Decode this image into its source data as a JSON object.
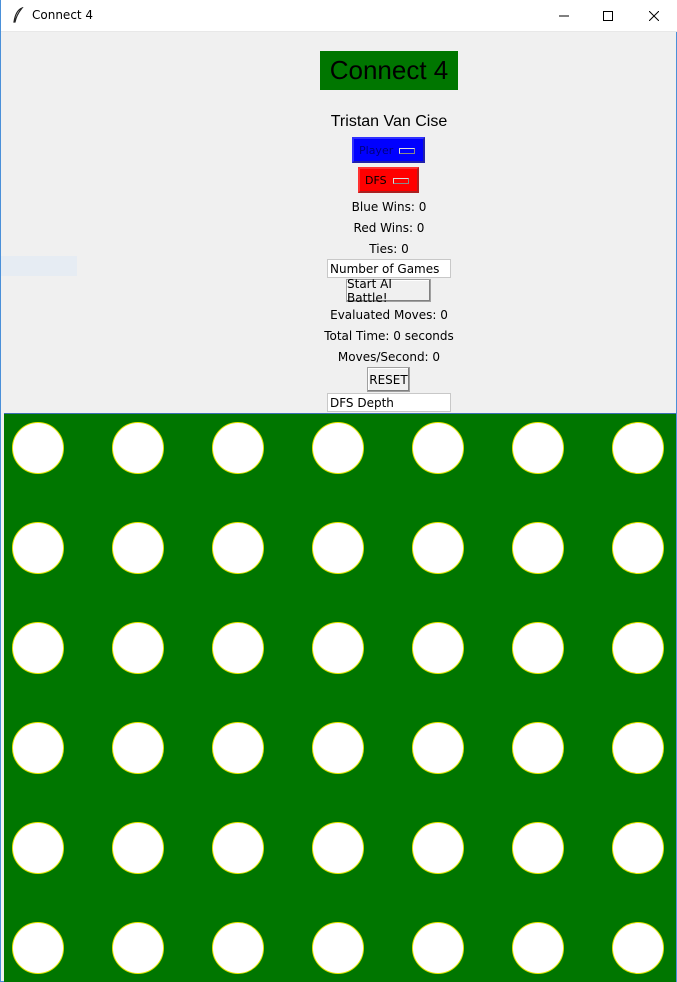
{
  "window": {
    "title": "Connect 4",
    "controls": [
      "minimize",
      "maximize",
      "close"
    ]
  },
  "header": {
    "title": "Connect 4",
    "author": "Tristan Van Cise"
  },
  "controls": {
    "player_menu": {
      "label": "Player",
      "color": "#0000ff"
    },
    "algorithm_menu": {
      "label": "DFS",
      "color": "#ff0000"
    },
    "blue_wins": "Blue Wins: 0",
    "red_wins": "Red Wins: 0",
    "ties": "Ties: 0",
    "games_input_value": "Number of Games",
    "start_button": "Start AI Battle!",
    "evaluated_moves": "Evaluated Moves: 0",
    "total_time": "Total Time: 0 seconds",
    "moves_per_second": "Moves/Second: 0",
    "reset_button": "RESET",
    "depth_input_value": "DFS Depth"
  },
  "board": {
    "columns": 7,
    "rows": 6,
    "background": "#007600",
    "empty_color": "#ffffff",
    "hole_outline": "#e6e600",
    "cells": [
      [
        "empty",
        "empty",
        "empty",
        "empty",
        "empty",
        "empty",
        "empty"
      ],
      [
        "empty",
        "empty",
        "empty",
        "empty",
        "empty",
        "empty",
        "empty"
      ],
      [
        "empty",
        "empty",
        "empty",
        "empty",
        "empty",
        "empty",
        "empty"
      ],
      [
        "empty",
        "empty",
        "empty",
        "empty",
        "empty",
        "empty",
        "empty"
      ],
      [
        "empty",
        "empty",
        "empty",
        "empty",
        "empty",
        "empty",
        "empty"
      ],
      [
        "empty",
        "empty",
        "empty",
        "empty",
        "empty",
        "empty",
        "empty"
      ]
    ]
  }
}
